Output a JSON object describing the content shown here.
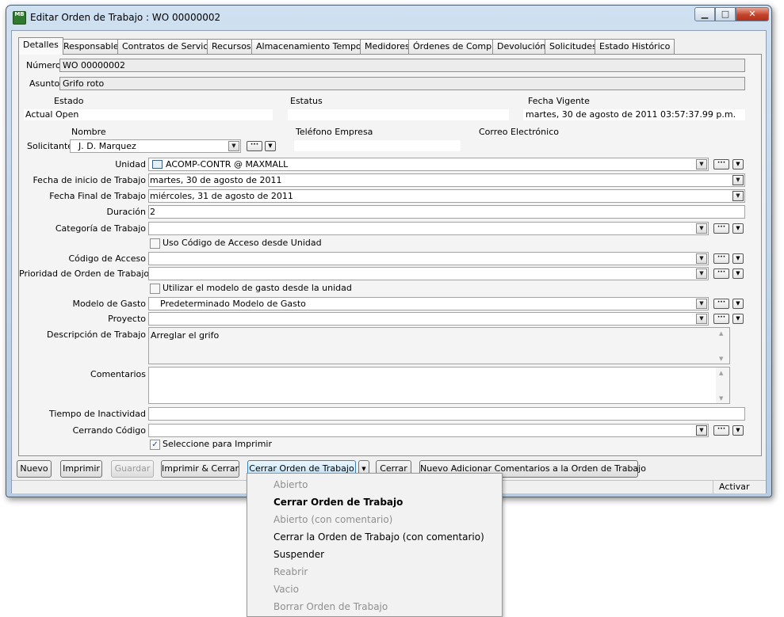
{
  "window": {
    "title": "Editar Orden de Trabajo : WO 00000002",
    "app_icon_text": "MB",
    "controls": {
      "minimize": "▁",
      "maximize": "□",
      "close": "✕"
    }
  },
  "tabs": [
    "Detalles",
    "Responsable",
    "Contratos de Servicio",
    "Recursos",
    "Almacenamiento Temporal",
    "Medidores",
    "Órdenes de Compra",
    "Devolución",
    "Solicitudes",
    "Estado Histórico"
  ],
  "form": {
    "numero_label": "Número",
    "numero_value": "WO 00000002",
    "asunto_label": "Asunto",
    "asunto_value": "Grifo roto",
    "estado_label": "Estado",
    "estado_value": "Actual Open",
    "estatus_label": "Estatus",
    "estatus_value": "",
    "fecha_vigente_label": "Fecha Vigente",
    "fecha_vigente_value": "martes, 30 de agosto de 2011 03:57:37.99 p.m.",
    "nombre_label": "Nombre",
    "solicitante_label": "Solicitante",
    "solicitante_value": "J. D. Marquez",
    "telefono_label": "Teléfono Empresa",
    "telefono_value": "",
    "correo_label": "Correo Electrónico",
    "unidad_label": "Unidad",
    "unidad_value": "ACOMP-CONTR @ MAXMALL",
    "fecha_inicio_label": "Fecha de inicio de Trabajo",
    "fecha_inicio_value": "martes, 30 de agosto de 2011",
    "fecha_final_label": "Fecha Final de Trabajo",
    "fecha_final_value": "miércoles, 31 de agosto de 2011",
    "duracion_label": "Duración",
    "duracion_value": "2",
    "categoria_label": "Categoría de Trabajo",
    "categoria_value": "",
    "uso_codigo_label": "Uso Código de Acceso desde Unidad",
    "codigo_acceso_label": "Código de Acceso",
    "prioridad_label": "Prioridad de Orden de Trabajo",
    "utilizar_modelo_label": "Utilizar el modelo de gasto desde la unidad",
    "modelo_gasto_label": "Modelo de Gasto",
    "modelo_gasto_value": "Predeterminado Modelo de Gasto",
    "proyecto_label": "Proyecto",
    "descripcion_label": "Descripción de Trabajo",
    "descripcion_value": "Arreglar el grifo",
    "comentarios_label": "Comentarios",
    "comentarios_value": "",
    "tiempo_inactividad_label": "Tiempo de Inactividad",
    "cerrando_codigo_label": "Cerrando Código",
    "seleccione_imprimir_label": "Seleccione para Imprimir",
    "seleccione_imprimir_checked": true
  },
  "buttons": {
    "nuevo": "Nuevo",
    "imprimir": "Imprimir",
    "guardar": "Guardar",
    "imprimir_cerrar": "Imprimir & Cerrar",
    "cerrar_orden": "Cerrar Orden de Trabajo",
    "cerrar": "Cerrar",
    "nuevo_comentarios": "Nuevo Adicionar Comentarios a la Orden de Trabajo"
  },
  "status": {
    "right": "Activar"
  },
  "menu": {
    "items": [
      {
        "label": "Abierto",
        "state": "disabled"
      },
      {
        "label": "Cerrar Orden de Trabajo",
        "state": "default"
      },
      {
        "label": "Abierto (con comentario)",
        "state": "disabled"
      },
      {
        "label": "Cerrar la Orden de Trabajo (con comentario)",
        "state": "enabled"
      },
      {
        "label": "Suspender",
        "state": "enabled"
      },
      {
        "label": "Reabrir",
        "state": "disabled"
      },
      {
        "label": "Vacio",
        "state": "disabled"
      },
      {
        "label": "Borrar Orden de Trabajo",
        "state": "disabled"
      }
    ]
  },
  "colors": {
    "window_frame": "#b7cce2",
    "close_button": "#c4432b",
    "focus_button": "#bfe2f7"
  }
}
